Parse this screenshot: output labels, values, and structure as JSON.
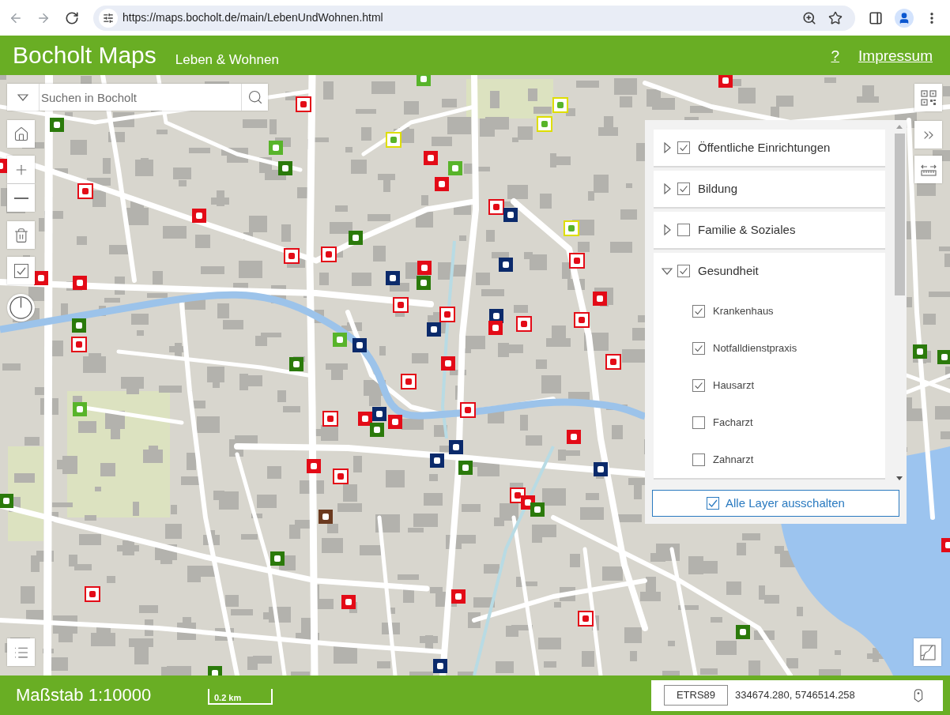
{
  "browser": {
    "url": "https://maps.bocholt.de/main/LebenUndWohnen.html"
  },
  "header": {
    "title": "Bocholt Maps",
    "subtitle": "Leben & Wohnen",
    "links": [
      "?",
      "Impressum"
    ]
  },
  "search": {
    "placeholder": "Suchen in Bocholt"
  },
  "layer_panel": {
    "groups": [
      {
        "label": "Öffentliche Einrichtungen",
        "checked": true,
        "expanded": false
      },
      {
        "label": "Bildung",
        "checked": true,
        "expanded": false
      },
      {
        "label": "Familie & Soziales",
        "checked": false,
        "expanded": false
      },
      {
        "label": "Gesundheit",
        "checked": true,
        "expanded": true,
        "children": [
          {
            "label": "Krankenhaus",
            "checked": true
          },
          {
            "label": "Notfalldienstpraxis",
            "checked": true
          },
          {
            "label": "Hausarzt",
            "checked": true
          },
          {
            "label": "Facharzt",
            "checked": false
          },
          {
            "label": "Zahnarzt",
            "checked": false
          }
        ]
      }
    ],
    "toggle_all": {
      "label": "Alle Layer ausschalten",
      "checked": true
    }
  },
  "status_bar": {
    "scale": "Maßstab 1:10000",
    "scale_bar": "0.2 km",
    "crs": "ETRS89",
    "coordinates": "334674.280, 5746514.258"
  }
}
